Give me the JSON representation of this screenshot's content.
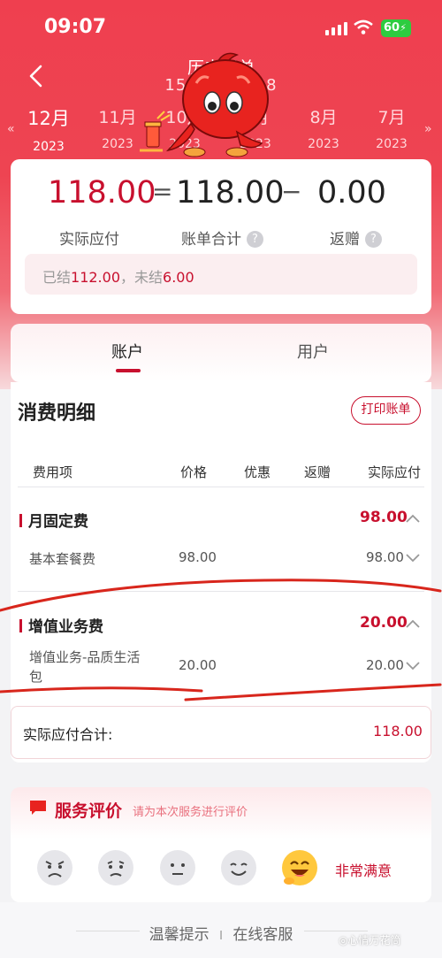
{
  "status_bar": {
    "time": "09:07",
    "battery": "60"
  },
  "nav": {
    "title": "历史账单",
    "subtitle": "155****8388"
  },
  "months": [
    {
      "month": "12月",
      "year": "2023",
      "active": true
    },
    {
      "month": "11月",
      "year": "2023"
    },
    {
      "month": "10月",
      "year": "2023"
    },
    {
      "month": "9月",
      "year": "2023"
    },
    {
      "month": "8月",
      "year": "2023"
    },
    {
      "month": "7月",
      "year": "2023"
    }
  ],
  "summary": {
    "actual_due": "118.00",
    "actual_due_label": "实际应付",
    "eq": "=",
    "bill_total": "118.00",
    "bill_total_label": "账单合计",
    "minus": "−",
    "rebate": "0.00",
    "rebate_label": "返赠",
    "help_icon": "?",
    "settled_label": "已结",
    "settled_value": "112.00",
    "unsettled_label": "，未结",
    "unsettled_value": "6.00"
  },
  "tabs": {
    "account": "账户",
    "user": "用户"
  },
  "detail": {
    "title": "消费明细",
    "print_label": "打印账单",
    "headers": [
      "费用项",
      "价格",
      "优惠",
      "返赠",
      "实际应付"
    ],
    "groups": [
      {
        "name": "月固定费",
        "total": "98.00",
        "items": [
          {
            "name": "基本套餐费",
            "price": "98.00",
            "due": "98.00"
          }
        ]
      },
      {
        "name": "增值业务费",
        "total": "20.00",
        "items": [
          {
            "name_line1": "增值业务-品质生活",
            "name_line2": "包",
            "price": "20.00",
            "due": "20.00"
          }
        ]
      }
    ],
    "total_label": "实际应付合计:",
    "total_value": "118.00"
  },
  "rating": {
    "title": "服务评价",
    "subtitle": "请为本次服务进行评价",
    "selected_label": "非常满意",
    "faces": [
      "angry-face-icon",
      "sad-face-icon",
      "neutral-face-icon",
      "smile-face-icon",
      "happy-face-icon"
    ]
  },
  "footer": {
    "tips": "温馨提示",
    "sep": "I",
    "service": "在线客服",
    "watermark": "◎心情万花筒"
  },
  "colors": {
    "brand_red": "#c8102e",
    "header_red": "#ee4452"
  }
}
